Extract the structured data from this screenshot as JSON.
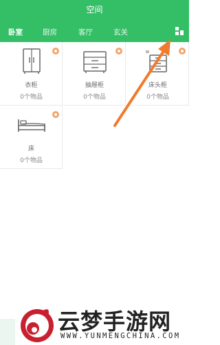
{
  "header": {
    "title": "空间",
    "tabs": [
      {
        "label": "卧室"
      },
      {
        "label": "厨房"
      },
      {
        "label": "客厅"
      },
      {
        "label": "玄关"
      }
    ],
    "layout_toggle_icon": "grid-view-icon"
  },
  "items": [
    {
      "name": "衣柜",
      "count": "0个物品",
      "icon": "wardrobe-icon"
    },
    {
      "name": "抽屉柜",
      "count": "0个物品",
      "icon": "drawer-cabinet-icon"
    },
    {
      "name": "床头柜",
      "count": "0个物品",
      "icon": "nightstand-icon"
    },
    {
      "name": "床",
      "count": "0个物品",
      "icon": "bed-icon"
    }
  ],
  "watermark": {
    "title": "云梦手游网",
    "url": "WWW.YUNMENGCHINA.COM"
  },
  "colors": {
    "header": "#34bf66",
    "badge": "#f0a56b",
    "arrow": "#f07b2e"
  }
}
